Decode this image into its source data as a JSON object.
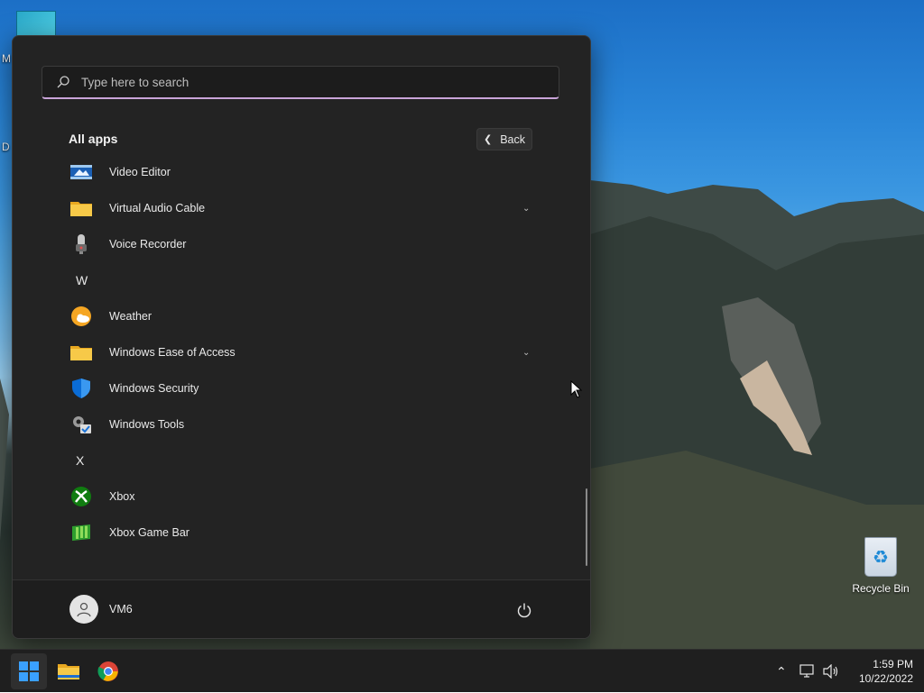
{
  "desktop": {
    "icons": [
      {
        "name": "recycle-bin",
        "label": "Recycle Bin"
      }
    ],
    "partial_letters": [
      "M",
      "D"
    ]
  },
  "start_menu": {
    "search": {
      "placeholder": "Type here to search",
      "value": ""
    },
    "all_apps_title": "All apps",
    "back_label": "Back",
    "items": [
      {
        "kind": "app",
        "label": "Video Editor",
        "icon": "video-editor-icon"
      },
      {
        "kind": "app",
        "label": "Virtual Audio Cable",
        "icon": "folder-icon",
        "expandable": true
      },
      {
        "kind": "app",
        "label": "Voice Recorder",
        "icon": "microphone-icon"
      },
      {
        "kind": "letter",
        "label": "W"
      },
      {
        "kind": "app",
        "label": "Weather",
        "icon": "weather-icon"
      },
      {
        "kind": "app",
        "label": "Windows Ease of Access",
        "icon": "folder-icon",
        "expandable": true
      },
      {
        "kind": "app",
        "label": "Windows Security",
        "icon": "shield-icon"
      },
      {
        "kind": "app",
        "label": "Windows Tools",
        "icon": "tools-icon"
      },
      {
        "kind": "letter",
        "label": "X"
      },
      {
        "kind": "app",
        "label": "Xbox",
        "icon": "xbox-icon"
      },
      {
        "kind": "app",
        "label": "Xbox Game Bar",
        "icon": "xbox-game-bar-icon"
      }
    ],
    "user_name": "VM6"
  },
  "taskbar": {
    "pinned": [
      "start-icon",
      "file-explorer-icon",
      "chrome-icon"
    ],
    "tray_icons": [
      "chevron-up-icon",
      "network-icon",
      "volume-icon"
    ],
    "time": "1:59 PM",
    "date": "10/22/2022"
  },
  "colors": {
    "menu_bg": "#232323",
    "search_accent": "#c9a4d8",
    "taskbar_bg": "#1f1f1f",
    "windows_blue": "#0078d4"
  }
}
